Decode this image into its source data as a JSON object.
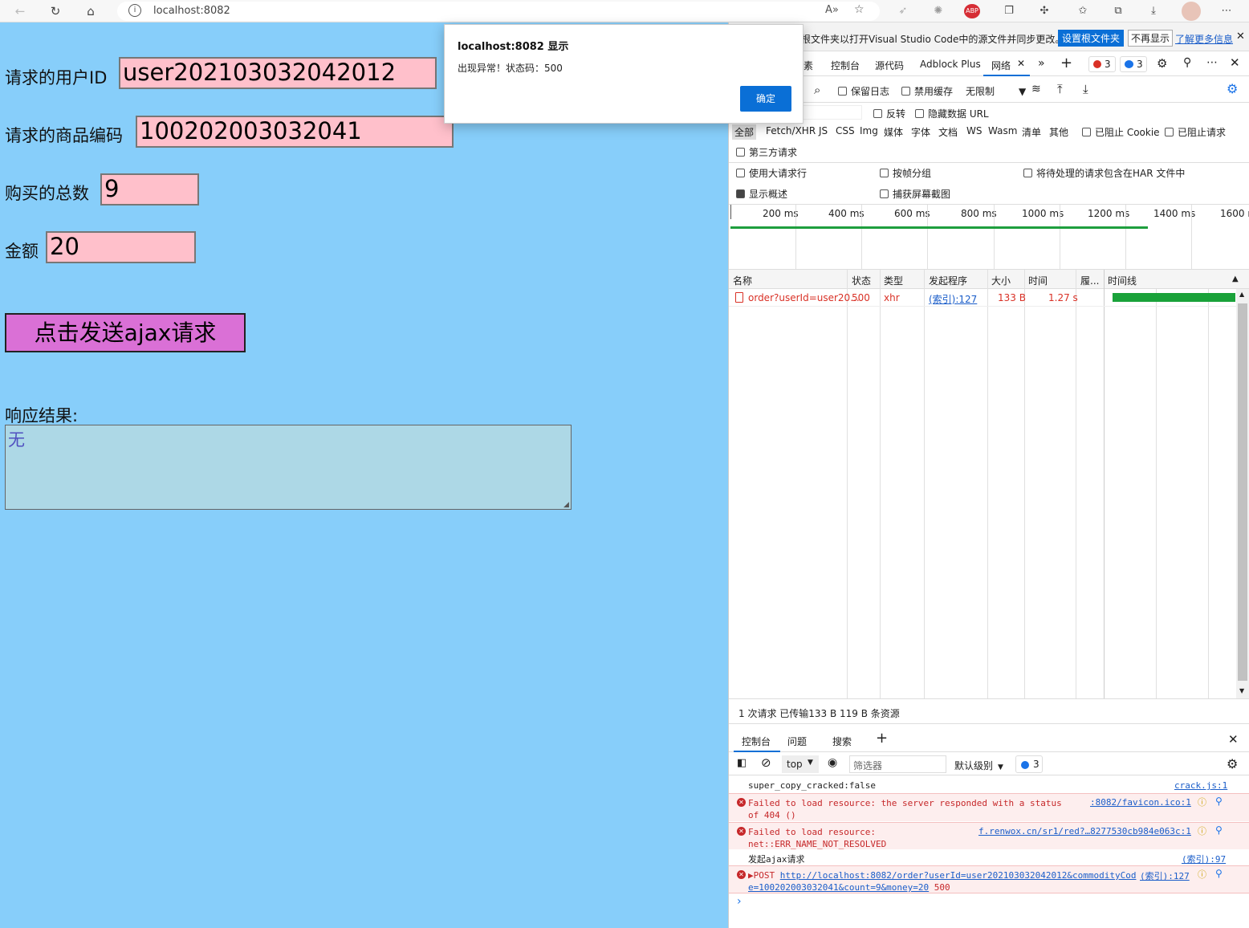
{
  "browser": {
    "url": "localhost:8082",
    "infobar_text": "根文件夹以打开Visual Studio Code中的源文件并同步更改。",
    "infobar_button": "设置根文件夹",
    "infobar_dismiss": "不再显示",
    "infobar_link": "了解更多信息"
  },
  "dialog": {
    "title": "localhost:8082 显示",
    "message": "出现异常！状态码：500",
    "ok": "确定"
  },
  "form": {
    "userid_label": "请求的用户ID",
    "userid_value": "user202103032042012",
    "commodity_label": "请求的商品编码",
    "commodity_value": "100202003032041",
    "count_label": "购买的总数",
    "count_value": "9",
    "money_label": "金额",
    "money_value": "20",
    "send_button": "点击发送ajax请求",
    "response_label": "响应结果:",
    "response_value": "无"
  },
  "devtools": {
    "tabs": [
      "素",
      "控制台",
      "源代码",
      "Adblock Plus",
      "网络"
    ],
    "error_count": "3",
    "message_count": "3",
    "toolbar": {
      "preserve_log": "保留日志",
      "disable_cache": "禁用缓存",
      "throttle": "无限制",
      "invert": "反转",
      "hide_data_urls": "隐藏数据 URL"
    },
    "filters": [
      "全部",
      "Fetch/XHR",
      "JS",
      "CSS",
      "Img",
      "媒体",
      "字体",
      "文档",
      "WS",
      "Wasm",
      "清单",
      "其他"
    ],
    "blocked_cookies": "已阻止 Cookie",
    "blocked_requests": "已阻止请求",
    "third_party": "第三方请求",
    "options": {
      "big_rows": "使用大请求行",
      "group_by_frame": "按帧分组",
      "har": "将待处理的请求包含在HAR 文件中",
      "overview": "显示概述",
      "screenshots": "捕获屏幕截图"
    },
    "timeline_ticks": [
      "200 ms",
      "400 ms",
      "600 ms",
      "800 ms",
      "1000 ms",
      "1200 ms",
      "1400 ms",
      "1600 n"
    ],
    "table_headers": [
      "名称",
      "状态",
      "类型",
      "发起程序",
      "大小",
      "时间",
      "履...",
      "时间线"
    ],
    "request": {
      "name": "order?userId=user20...",
      "status": "500",
      "type": "xhr",
      "initiator": "(索引):127",
      "size": "133 B",
      "time": "1.27 s"
    },
    "summary": "1 次请求  已传输133 B  119 B 条资源",
    "drawer_tabs": [
      "控制台",
      "问题",
      "搜索"
    ],
    "console_context": "top",
    "console_filter_placeholder": "筛选器",
    "console_level": "默认级别",
    "console_issue_count": "3",
    "console": [
      {
        "type": "log",
        "text": "super_copy_cracked:false",
        "source": "crack.js:1"
      },
      {
        "type": "error",
        "text": "Failed to load resource: the server responded with a status of 404 ()",
        "source": ":8082/favicon.ico:1"
      },
      {
        "type": "error",
        "text": "Failed to load resource: net::ERR_NAME_NOT_RESOLVED",
        "source": "f.renwox.cn/sr1/red?…8277530cb984e063c:1"
      },
      {
        "type": "log",
        "text": "发起ajax请求",
        "source": "(索引):97"
      },
      {
        "type": "error",
        "prefix": "▶POST",
        "url": "http://localhost:8082/order?userId=user202103032042012&commodityCode=100202003032041&count=9&money=20",
        "status": "500",
        "source": "(索引):127"
      }
    ],
    "prompt": "›"
  }
}
